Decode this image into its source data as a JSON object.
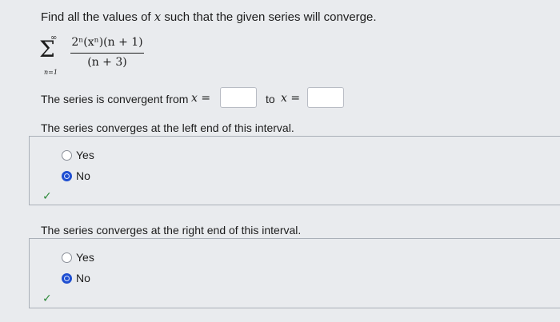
{
  "question": {
    "prompt_before": "Find all the values of ",
    "prompt_var": "x",
    "prompt_after": " such that the given series will converge.",
    "series": {
      "upper": "∞",
      "lower": "n=1",
      "numerator": "2ⁿ(xⁿ)(n + 1)",
      "denominator": "(n + 3)"
    },
    "interval_label": "The series is convergent from",
    "from_var": "x =",
    "to_label": "to",
    "to_var": "x ="
  },
  "left_end": {
    "prompt": "The series converges at the left end of this interval.",
    "options": [
      "Yes",
      "No"
    ],
    "selected": "No",
    "check": "✓"
  },
  "right_end": {
    "prompt": "The series converges at the right end of this interval.",
    "options": [
      "Yes",
      "No"
    ],
    "selected": "No",
    "check": "✓"
  }
}
